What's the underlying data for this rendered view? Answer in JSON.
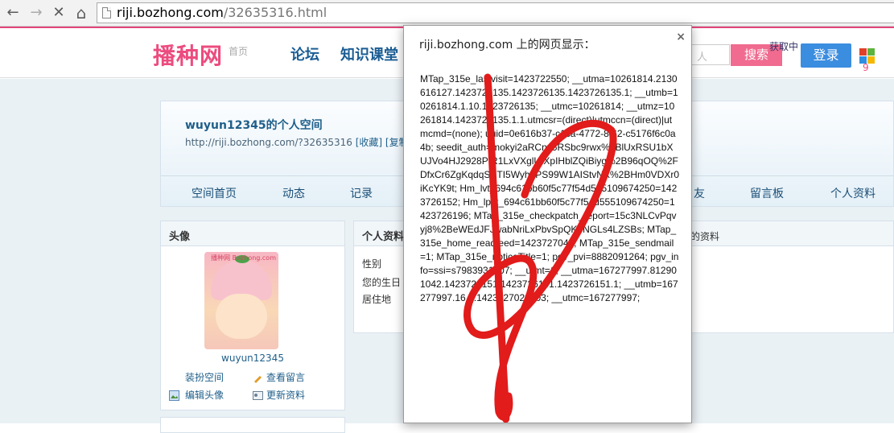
{
  "browser": {
    "back_icon": "←",
    "forward_icon": "→",
    "stop_icon": "✕",
    "home_icon": "⌂",
    "url_domain": "riji.bozhong.com",
    "url_path": "/32635316.html"
  },
  "site": {
    "logo": "播种网",
    "home_link": "首页",
    "nav": [
      "论坛",
      "知识课堂"
    ],
    "search_placeholder": "人",
    "search_button": "搜索",
    "fetching": "获取中",
    "login_button": "登录",
    "colors": {
      "brand_pink": "#ec4c7f",
      "login_blue": "#3b8de0",
      "search_pink": "#f06b8f"
    }
  },
  "space": {
    "title": "wuyun12345的个人空间",
    "url_text": "http://riji.bozhong.com/?32635316",
    "favorite_link": "[收藏]",
    "copy_link": "[复制]",
    "nav": [
      "空间首页",
      "动态",
      "记录",
      "友",
      "留言板",
      "个人资料"
    ]
  },
  "avatar_panel": {
    "heading": "头像",
    "image_caption": "播种网 Bozhong.com",
    "username": "wuyun12345",
    "links": [
      "装扮空间",
      "查看留言",
      "编辑头像",
      "更新资料"
    ]
  },
  "profile_panel": {
    "heading": "个人资料",
    "right_text": "的资料",
    "rows": [
      "性别",
      "您的生日",
      "居住地"
    ]
  },
  "dialog": {
    "title": "riji.bozhong.com 上的网页显示：",
    "close_icon": "×",
    "body": "MTap_315e_lastvisit=1423722550; __utma=10261814.2130616127.1423726135.1423726135.1423726135.1; __utmb=10261814.1.10.1423726135; __utmc=10261814; __utmz=10261814.1423726135.1.1.utmcsr=(direct)|utmccn=(direct)|utmcmd=(none); uuid=0e616b37-c1ca-4772-8f62-c5176f6c0a4b; seedit_auth=mokyi2aRCny5RSbc9rwx%2BlUxRSU1bXUJVo4HJ2928PtR1LxVXglUIXpIHblZQiBiyg%2B96qOQ%2FDfxCr6ZgKqdqSXTI5Wyh2PS99W1AIStvNX%2BHm0VDXr0iKcYK9t; Hm_lvt_694c61bb60f5c77f54d555109674250=1423726152; Hm_lpvt_694c61bb60f5c77f54d555109674250=1423726196; MTap_315e_checkpatch_report=15c3NLCvPqvyj8%2BeWEdJFJwabNriLxPbvSpQK7NGLs4LZSBs; MTap_315e_home_readfeed=1423727049; MTap_315e_sendmail=1; MTap_315e_noticeTitle=1; pgv_pvi=8882091264; pgv_info=ssi=s7983931607; __utmt=1; __utma=167277997.812901042.1423726151.1423726151.1423726151.1; __utmb=167277997.16.9.1423727029203; __utmc=167277997;"
  }
}
